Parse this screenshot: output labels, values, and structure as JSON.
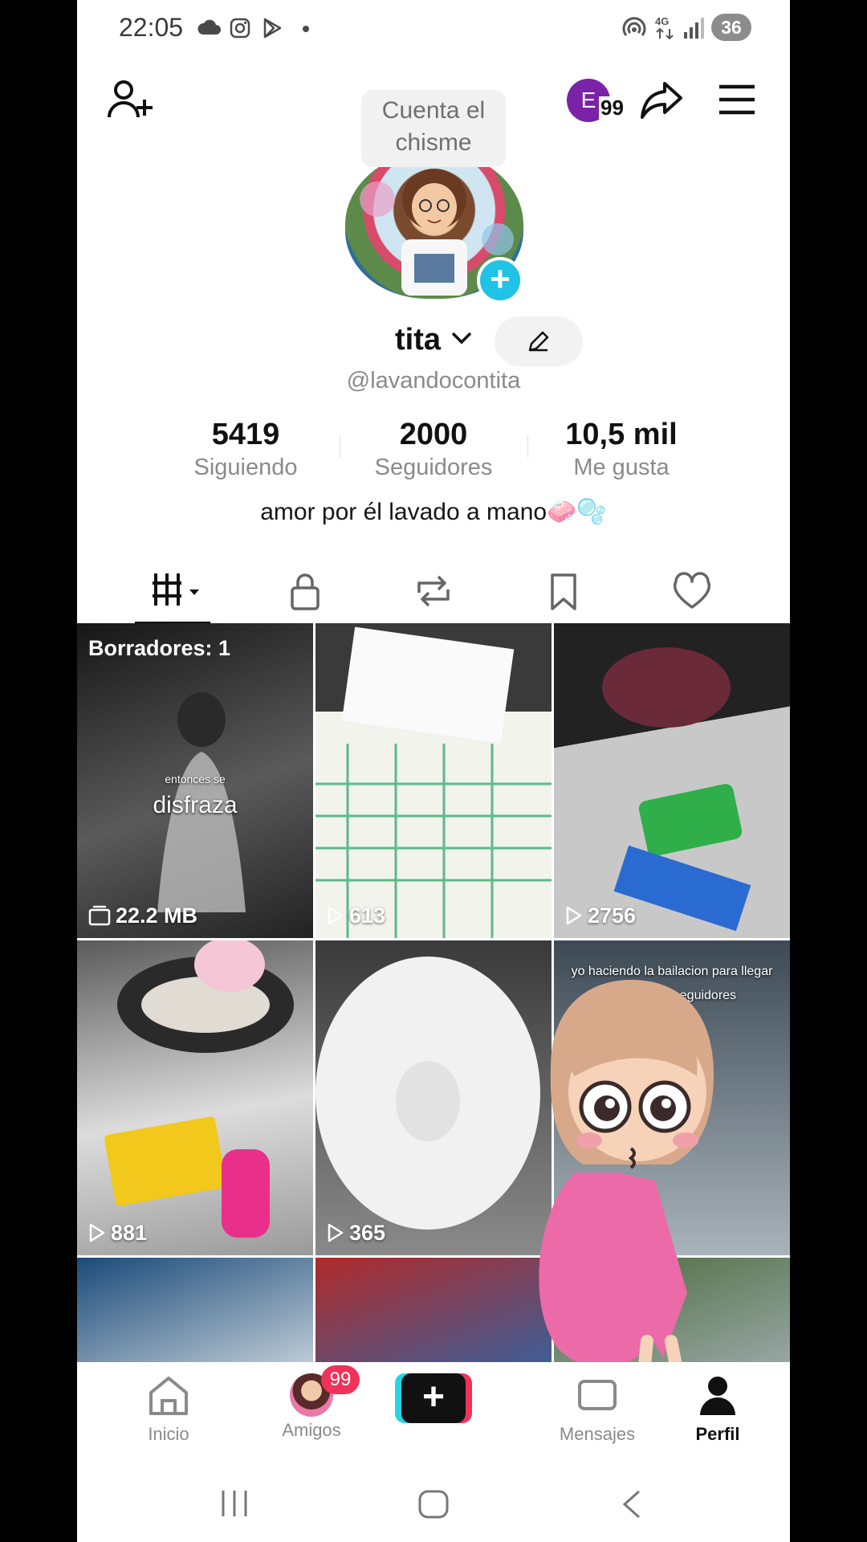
{
  "status_bar": {
    "time": "22:05",
    "icons": [
      "cloud-icon",
      "instagram-icon",
      "play-store-icon",
      "dot-icon"
    ],
    "right_icons": [
      "hotspot-icon",
      "network-4g-icon",
      "signal-icon"
    ],
    "battery": "36"
  },
  "top_bar": {
    "avatar_letter": "E",
    "avatar_badge": "99"
  },
  "profile": {
    "story_bubble": "Cuenta el chisme",
    "username": "tita",
    "handle": "@lavandocontita",
    "bio": "amor por él lavado a mano🧼🫧",
    "stats": [
      {
        "value": "5419",
        "label": "Siguiendo"
      },
      {
        "value": "2000",
        "label": "Seguidores"
      },
      {
        "value": "10,5 mil",
        "label": "Me gusta"
      }
    ]
  },
  "tabs": [
    "videos-tab",
    "private-tab",
    "reposts-tab",
    "saved-tab",
    "liked-tab"
  ],
  "grid": {
    "drafts_label": "Borradores: 1",
    "tiles": [
      {
        "count": "22.2 MB",
        "overlay_small": "entonces se",
        "overlay_big": "disfraza",
        "colors": [
          "#1c1c1c",
          "#6a6a6a"
        ]
      },
      {
        "count": "613",
        "colors": [
          "#3a3a3a",
          "#eef1e8"
        ]
      },
      {
        "count": "2756",
        "colors": [
          "#2a2a2a",
          "#b8b8b8"
        ]
      },
      {
        "count": "881",
        "colors": [
          "#7a7a7a",
          "#d9d9d9"
        ]
      },
      {
        "count": "365",
        "colors": [
          "#555",
          "#eaeaea"
        ]
      },
      {
        "count": "",
        "overlay_small": "yo haciendo la bailacion para llegar a los 2k de seguidores",
        "colors": [
          "#3d4a55",
          "#a9b3bb"
        ]
      },
      {
        "count": "",
        "colors": [
          "#1b4a7a",
          "#c2cfd8"
        ]
      },
      {
        "count": "",
        "colors": [
          "#b02a2a",
          "#3a5f9a"
        ]
      },
      {
        "count": "",
        "colors": [
          "#4a6a3a",
          "#9aa"
        ]
      }
    ]
  },
  "bottom_nav": {
    "items": [
      {
        "label": "Inicio"
      },
      {
        "label": "Amigos",
        "badge": "99"
      },
      {
        "label": "Mensajes"
      },
      {
        "label": "Perfil"
      }
    ]
  }
}
